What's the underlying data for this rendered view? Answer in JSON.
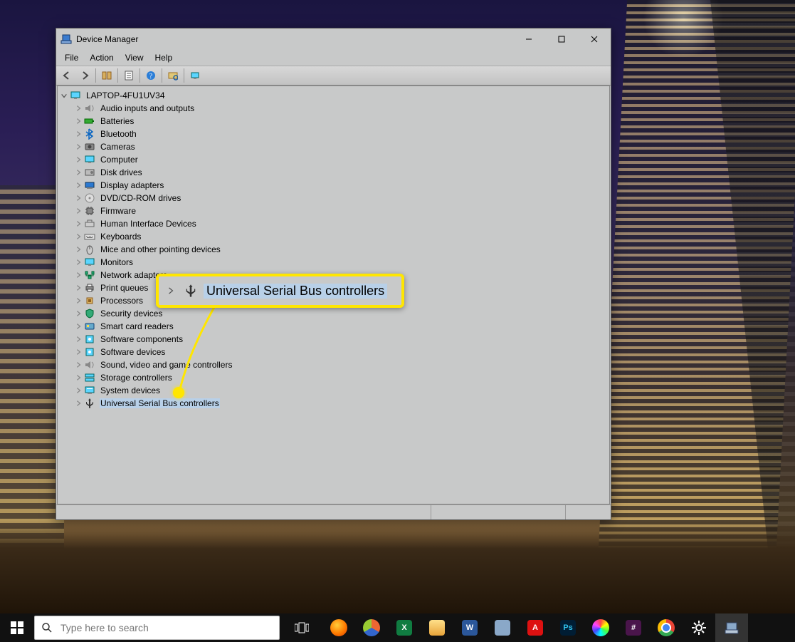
{
  "window": {
    "title": "Device Manager",
    "menu": {
      "file": "File",
      "action": "Action",
      "view": "View",
      "help": "Help"
    }
  },
  "tree": {
    "root": "LAPTOP-4FU1UV34",
    "items": [
      {
        "label": "Audio inputs and outputs",
        "icon": "audio"
      },
      {
        "label": "Batteries",
        "icon": "battery"
      },
      {
        "label": "Bluetooth",
        "icon": "bluetooth"
      },
      {
        "label": "Cameras",
        "icon": "camera"
      },
      {
        "label": "Computer",
        "icon": "monitor"
      },
      {
        "label": "Disk drives",
        "icon": "disk"
      },
      {
        "label": "Display adapters",
        "icon": "display"
      },
      {
        "label": "DVD/CD-ROM drives",
        "icon": "cd"
      },
      {
        "label": "Firmware",
        "icon": "chip"
      },
      {
        "label": "Human Interface Devices",
        "icon": "hid"
      },
      {
        "label": "Keyboards",
        "icon": "keyboard"
      },
      {
        "label": "Mice and other pointing devices",
        "icon": "mouse"
      },
      {
        "label": "Monitors",
        "icon": "monitor"
      },
      {
        "label": "Network adapters",
        "icon": "network"
      },
      {
        "label": "Print queues",
        "icon": "printer"
      },
      {
        "label": "Processors",
        "icon": "cpu"
      },
      {
        "label": "Security devices",
        "icon": "security"
      },
      {
        "label": "Smart card readers",
        "icon": "smartcard"
      },
      {
        "label": "Software components",
        "icon": "soft"
      },
      {
        "label": "Software devices",
        "icon": "soft"
      },
      {
        "label": "Sound, video and game controllers",
        "icon": "audio"
      },
      {
        "label": "Storage controllers",
        "icon": "storage"
      },
      {
        "label": "System devices",
        "icon": "system"
      },
      {
        "label": "Universal Serial Bus controllers",
        "icon": "usb",
        "selected": true
      }
    ]
  },
  "callout": {
    "label": "Universal Serial Bus controllers"
  },
  "taskbar": {
    "search_placeholder": "Type here to search"
  }
}
